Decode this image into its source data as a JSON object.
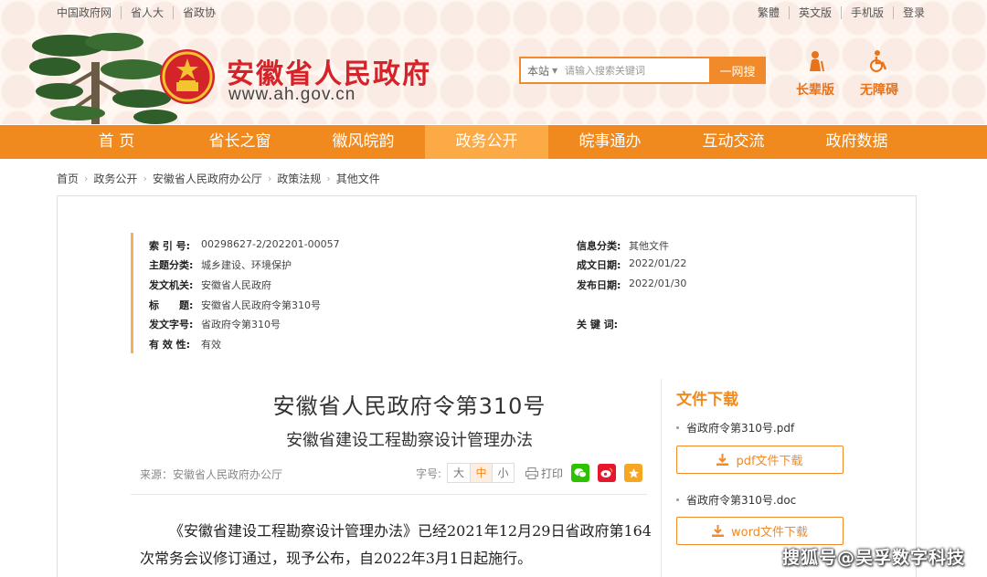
{
  "header": {
    "top_links_left": [
      "中国政府网",
      "省人大",
      "省政协"
    ],
    "top_links_right": [
      "繁體",
      "英文版",
      "手机版",
      "登录"
    ],
    "site_title": "安徽省人民政府",
    "site_url": "www.ah.gov.cn",
    "search": {
      "scope": "本站",
      "placeholder": "请输入搜索关键词",
      "button": "一网搜"
    },
    "quick_links": [
      "长辈版",
      "无障碍"
    ]
  },
  "nav": {
    "items": [
      "首 页",
      "省长之窗",
      "徽风皖韵",
      "政务公开",
      "皖事通办",
      "互动交流",
      "政府数据"
    ],
    "active": "政务公开"
  },
  "breadcrumb": [
    "首页",
    "政务公开",
    "安徽省人民政府办公厅",
    "政策法规",
    "其他文件"
  ],
  "meta": {
    "index_no": {
      "label": "索 引 号:",
      "value": "00298627-2/202201-00057"
    },
    "topic": {
      "label": "主题分类:",
      "value": "城乡建设、环境保护"
    },
    "issuer": {
      "label": "发文机关:",
      "value": "安徽省人民政府"
    },
    "title": {
      "label": "标　　题:",
      "value": "安徽省人民政府令第310号"
    },
    "doc_no": {
      "label": "发文字号:",
      "value": "省政府令第310号"
    },
    "validity": {
      "label": "有 效 性:",
      "value": "有效"
    },
    "info_cat": {
      "label": "信息分类:",
      "value": "其他文件"
    },
    "created": {
      "label": "成文日期:",
      "value": "2022/01/22"
    },
    "published": {
      "label": "发布日期:",
      "value": "2022/01/30"
    },
    "keywords": {
      "label": "关 键 词:",
      "value": ""
    }
  },
  "article": {
    "title": "安徽省人民政府令第310号",
    "subtitle": "安徽省建设工程勘察设计管理办法",
    "source": "来源：安徽省人民政府办公厅",
    "font_label": "字号:",
    "font_sizes": [
      "大",
      "中",
      "小"
    ],
    "font_active": "中",
    "print_label": "打印",
    "body": "《安徽省建设工程勘察设计管理办法》已经2021年12月29日省政府第164次常务会议修订通过，现予公布，自2022年3月1日起施行。"
  },
  "downloads": {
    "title": "文件下载",
    "files": [
      {
        "name": "省政府令第310号.pdf",
        "button": "pdf文件下载"
      },
      {
        "name": "省政府令第310号.doc",
        "button": "word文件下载"
      }
    ]
  },
  "watermark": "搜狐号@吴孚数字科技",
  "colors": {
    "brand_orange": "#f08a1e",
    "title_red": "#d4242a",
    "nav_active": "#fbaa46"
  }
}
